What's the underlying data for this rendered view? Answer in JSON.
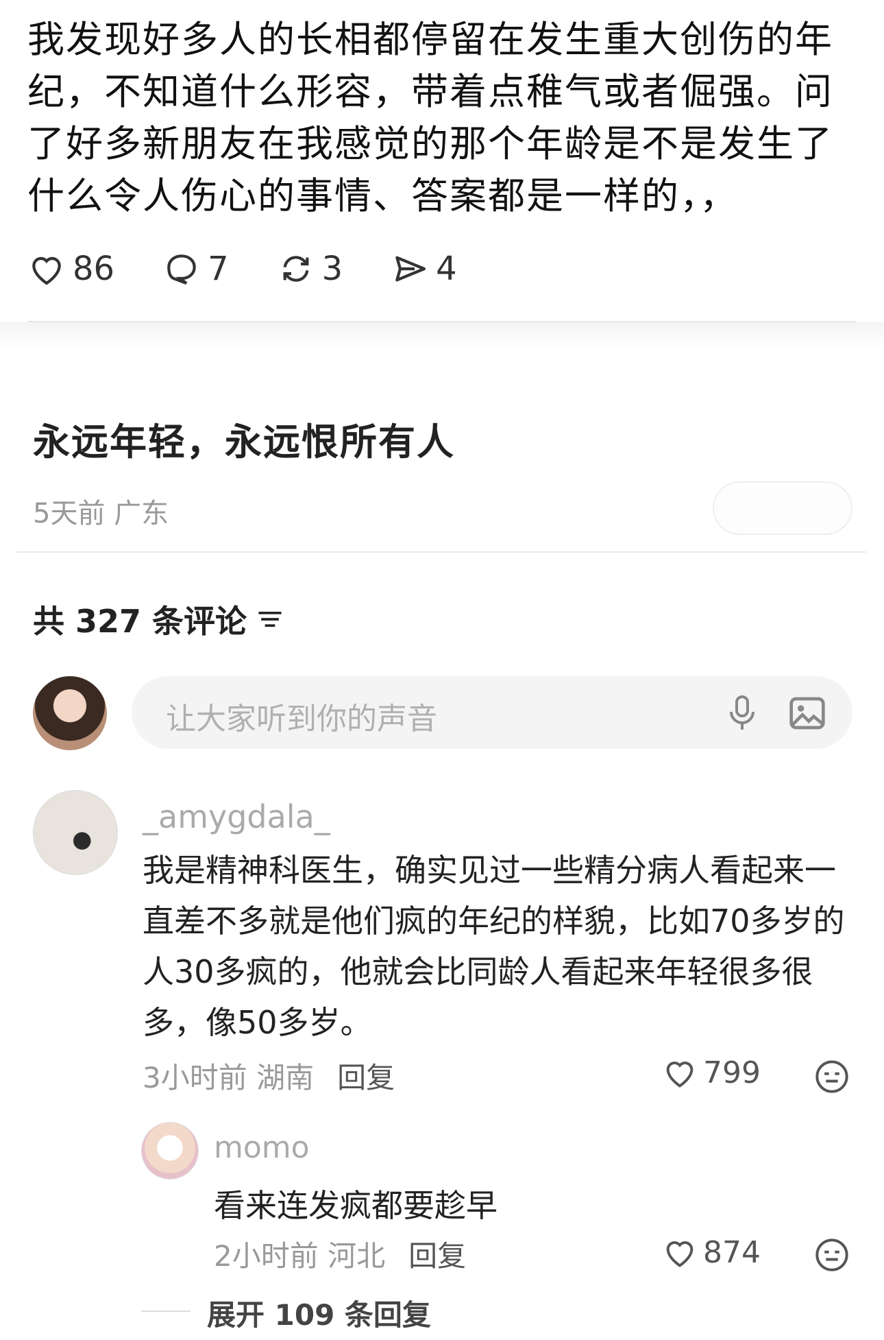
{
  "post": {
    "text": "我发现好多人的长相都停留在发生重大创伤的年纪，不知道什么形容，带着点稚气或者倔强。问了好多新朋友在我感觉的那个年龄是不是发生了什么令人伤心的事情、答案都是一样的，，",
    "likes": "86",
    "comments": "7",
    "reposts": "3",
    "shares": "4",
    "title": "永远年轻，永远恨所有人",
    "meta": "5天前 广东"
  },
  "comments_section": {
    "count_label": "共 327 条评论",
    "input_placeholder": "让大家听到你的声音"
  },
  "comments": [
    {
      "username": "_amygdala_",
      "text": "我是精神科医生，确实见过一些精分病人看起来一直差不多就是他们疯的年纪的样貌，比如70多岁的人30多疯的，他就会比同龄人看起来年轻很多很多，像50多岁。",
      "meta": "3小时前 湖南",
      "reply_label": "回复",
      "likes": "799"
    }
  ],
  "replies": [
    {
      "username": "momo",
      "text": "看来连发疯都要趁早",
      "meta": "2小时前 河北",
      "reply_label": "回复",
      "likes": "874"
    }
  ],
  "expand_label": "展开 109 条回复"
}
